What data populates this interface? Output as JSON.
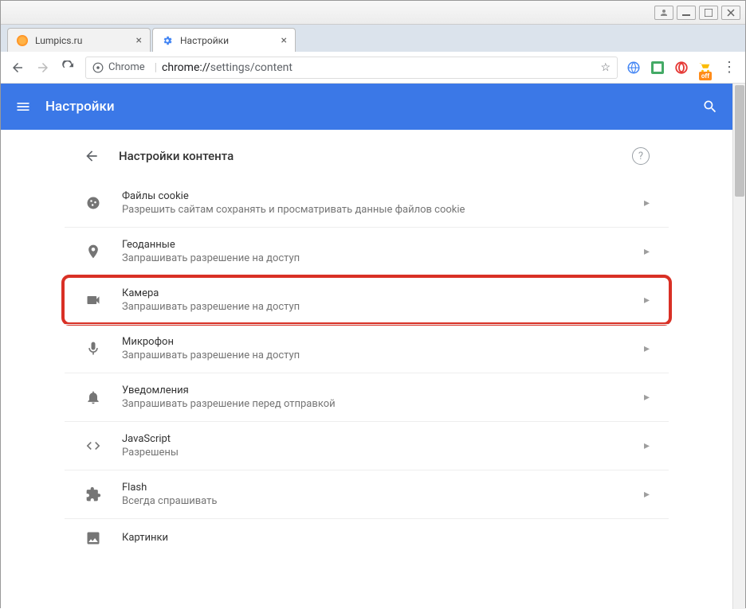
{
  "window": {
    "controls": [
      "minimize",
      "maximize",
      "close"
    ]
  },
  "tabs": [
    {
      "label": "Lumpics.ru",
      "favicon": "orange"
    },
    {
      "label": "Настройки",
      "favicon": "gear",
      "active": true
    }
  ],
  "addressbar": {
    "scheme_label": "Chrome",
    "url_host": "chrome://",
    "url_path": "settings/content",
    "star_icon": "star",
    "extensions": [
      "globe",
      "square-blue",
      "opera-o",
      "cart"
    ],
    "off_badge": "off"
  },
  "settings": {
    "header_title": "Настройки",
    "card_title": "Настройки контента",
    "help": "?",
    "items": [
      {
        "icon": "cookie",
        "title": "Файлы cookie",
        "sub": "Разрешить сайтам сохранять и просматривать данные файлов cookie"
      },
      {
        "icon": "location",
        "title": "Геоданные",
        "sub": "Запрашивать разрешение на доступ"
      },
      {
        "icon": "camera",
        "title": "Камера",
        "sub": "Запрашивать разрешение на доступ",
        "highlighted": true
      },
      {
        "icon": "mic",
        "title": "Микрофон",
        "sub": "Запрашивать разрешение на доступ"
      },
      {
        "icon": "bell",
        "title": "Уведомления",
        "sub": "Запрашивать разрешение перед отправкой"
      },
      {
        "icon": "code",
        "title": "JavaScript",
        "sub": "Разрешены"
      },
      {
        "icon": "puzzle",
        "title": "Flash",
        "sub": "Всегда спрашивать"
      },
      {
        "icon": "image",
        "title": "Картинки",
        "sub": ""
      }
    ]
  }
}
